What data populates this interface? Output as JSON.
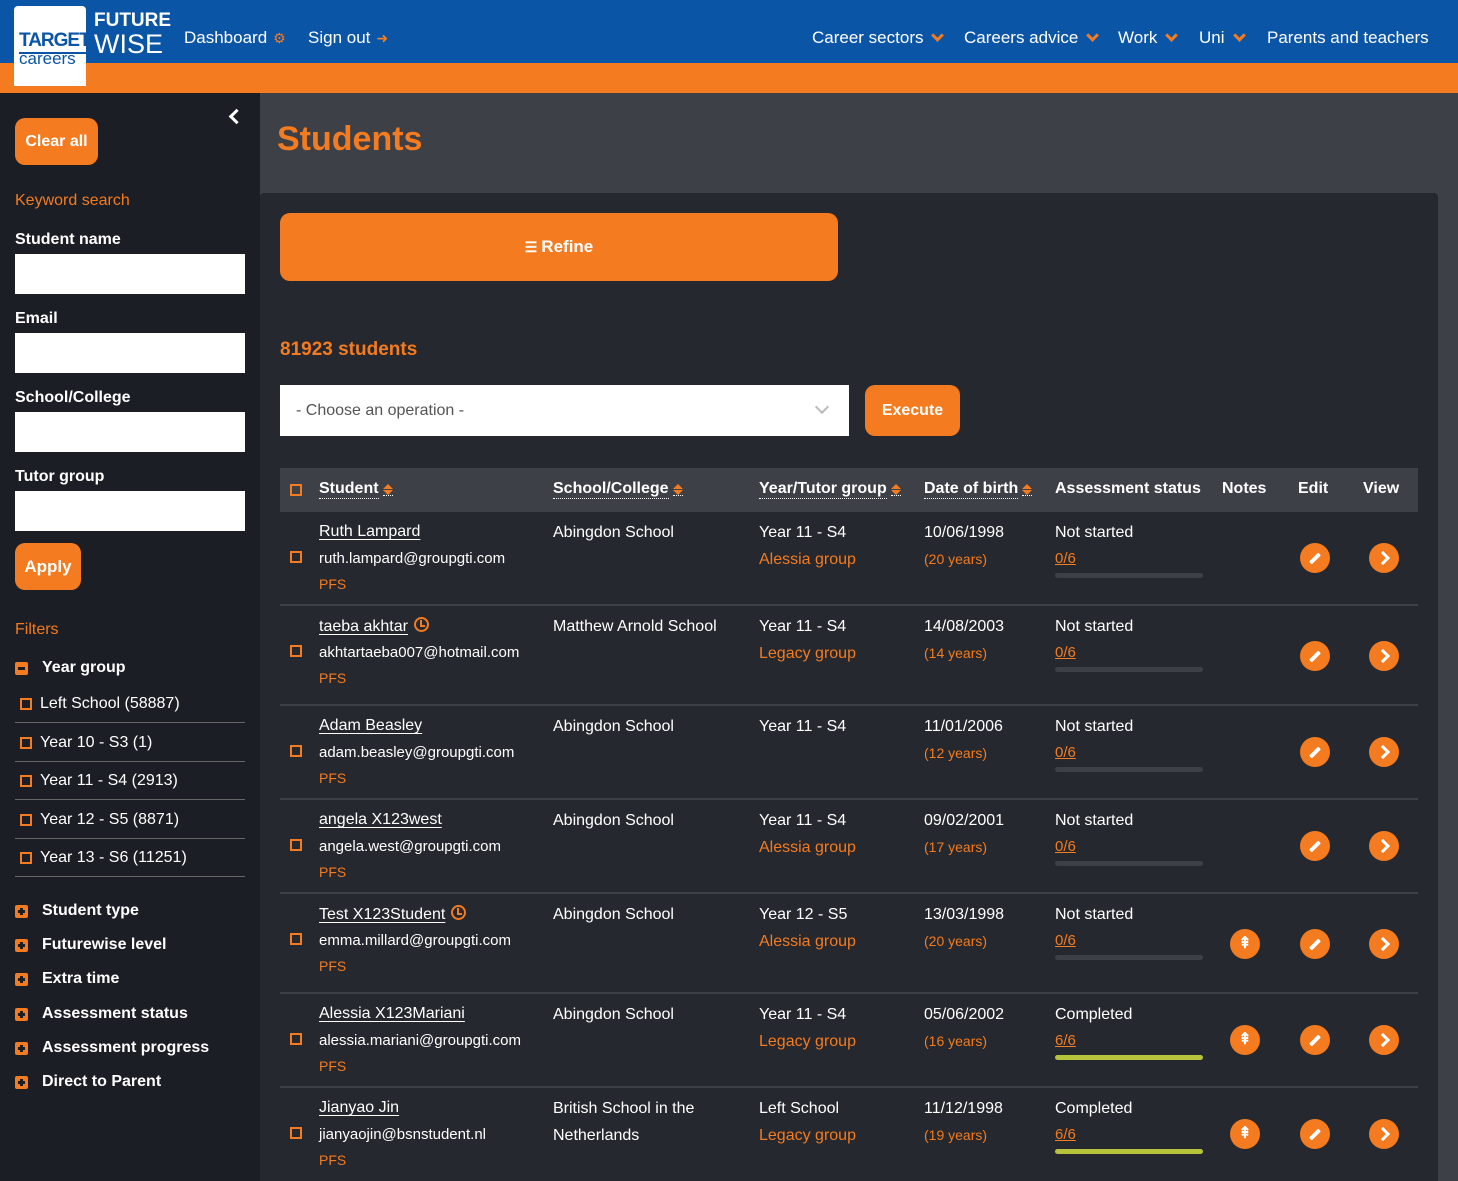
{
  "brand": {
    "top": "TARGET",
    "bottom": "careers",
    "future": "FUTURE",
    "wise": "WISE"
  },
  "nav": {
    "dashboard": "Dashboard",
    "signout": "Sign out",
    "right": [
      {
        "label": "Career sectors",
        "dropdown": true
      },
      {
        "label": "Careers advice",
        "dropdown": true
      },
      {
        "label": "Work",
        "dropdown": true
      },
      {
        "label": "Uni",
        "dropdown": true
      },
      {
        "label": "Parents and teachers",
        "dropdown": false
      }
    ]
  },
  "sidebar": {
    "clear_all": "Clear all",
    "keyword_search": "Keyword search",
    "fields": [
      "Student name",
      "Email",
      "School/College",
      "Tutor group"
    ],
    "apply": "Apply",
    "filters": "Filters",
    "year_group": {
      "title": "Year group",
      "items": [
        "Left School (58887)",
        "Year 10 - S3 (1)",
        "Year 11 - S4 (2913)",
        "Year 12 - S5 (8871)",
        "Year 13 - S6 (11251)"
      ]
    },
    "collapsed_filters": [
      "Student type",
      "Futurewise level",
      "Extra time",
      "Assessment status",
      "Assessment progress",
      "Direct to Parent"
    ]
  },
  "main": {
    "title": "Students",
    "refine": "Refine",
    "count": "81923 students",
    "operation_placeholder": "- Choose an operation -",
    "execute": "Execute",
    "headers": {
      "student": "Student",
      "school": "School/College",
      "year": "Year/Tutor group",
      "dob": "Date of birth",
      "status": "Assessment status",
      "notes": "Notes",
      "edit": "Edit",
      "view": "View"
    },
    "students": [
      {
        "name": "Ruth Lampard",
        "clock": false,
        "email": "ruth.lampard@groupgti.com",
        "type": "PFS",
        "school": [
          "Abingdon School"
        ],
        "year": "Year 11 - S4",
        "group": "Alessia group",
        "dob": "10/06/1998",
        "age": "(20 years)",
        "status": "Not started",
        "progress": "0/6",
        "progress_value": 0,
        "notes": false
      },
      {
        "name": "taeba akhtar",
        "clock": true,
        "email": "akhtartaeba007@hotmail.com",
        "type": "PFS",
        "school": [
          "Matthew Arnold School"
        ],
        "year": "Year 11 - S4",
        "group": "Legacy group",
        "dob": "14/08/2003",
        "age": "(14 years)",
        "status": "Not started",
        "progress": "0/6",
        "progress_value": 0,
        "notes": false
      },
      {
        "name": "Adam Beasley",
        "clock": false,
        "email": "adam.beasley@groupgti.com",
        "type": "PFS",
        "school": [
          "Abingdon School"
        ],
        "year": "Year 11 - S4",
        "group": "",
        "dob": "11/01/2006",
        "age": "(12 years)",
        "status": "Not started",
        "progress": "0/6",
        "progress_value": 0,
        "notes": false
      },
      {
        "name": "angela X123west",
        "clock": false,
        "email": "angela.west@groupgti.com",
        "type": "PFS",
        "school": [
          "Abingdon School"
        ],
        "year": "Year 11 - S4",
        "group": "Alessia group",
        "dob": "09/02/2001",
        "age": "(17 years)",
        "status": "Not started",
        "progress": "0/6",
        "progress_value": 0,
        "notes": false
      },
      {
        "name": "Test X123Student",
        "clock": true,
        "email": "emma.millard@groupgti.com",
        "type": "PFS",
        "school": [
          "Abingdon School"
        ],
        "year": "Year 12 - S5",
        "group": "Alessia group",
        "dob": "13/03/1998",
        "age": "(20 years)",
        "status": "Not started",
        "progress": "0/6",
        "progress_value": 0,
        "notes": true
      },
      {
        "name": "Alessia X123Mariani",
        "clock": false,
        "email": "alessia.mariani@groupgti.com",
        "type": "PFS",
        "school": [
          "Abingdon School"
        ],
        "year": "Year 11 - S4",
        "group": "Legacy group",
        "dob": "05/06/2002",
        "age": "(16 years)",
        "status": "Completed",
        "progress": "6/6",
        "progress_value": 1,
        "notes": true
      },
      {
        "name": "Jianyao Jin",
        "clock": false,
        "email": "jianyaojin@bsnstudent.nl",
        "type": "PFS",
        "school": [
          "British School in the",
          "Netherlands"
        ],
        "year": "Left School",
        "group": "Legacy group",
        "dob": "11/12/1998",
        "age": "(19 years)",
        "status": "Completed",
        "progress": "6/6",
        "progress_value": 1,
        "notes": true
      }
    ]
  },
  "colors": {
    "brand_blue": "#0b55a6",
    "accent_orange": "#f47b20",
    "progress_green": "#b7c43b"
  }
}
